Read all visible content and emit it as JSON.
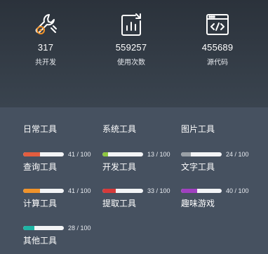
{
  "stats": [
    {
      "icon": "wrench-gear-icon",
      "value": "317",
      "label": "共开发"
    },
    {
      "icon": "bar-chart-icon",
      "value": "559257",
      "label": "使用次数"
    },
    {
      "icon": "code-window-icon",
      "value": "455689",
      "label": "源代码"
    }
  ],
  "categories": [
    "日常工具",
    "系统工具",
    "图片工具"
  ],
  "tools": [
    {
      "name": "查询工具",
      "used": 41,
      "total": 100,
      "count_text": "41 / 100",
      "color": "#e35d3f"
    },
    {
      "name": "开发工具",
      "used": 13,
      "total": 100,
      "count_text": "13 / 100",
      "color": "#8dc63f"
    },
    {
      "name": "文字工具",
      "used": 24,
      "total": 100,
      "count_text": "24 / 100",
      "color": "#9aa0a6"
    },
    {
      "name": "计算工具",
      "used": 41,
      "total": 100,
      "count_text": "41 / 100",
      "color": "#f0932b"
    },
    {
      "name": "提取工具",
      "used": 33,
      "total": 100,
      "count_text": "33 / 100",
      "color": "#d63a3a"
    },
    {
      "name": "趣味游戏",
      "used": 40,
      "total": 100,
      "count_text": "40 / 100",
      "color": "#a040c0"
    },
    {
      "name": "其他工具",
      "used": 28,
      "total": 100,
      "count_text": "28 / 100",
      "color": "#1fb5a5"
    }
  ]
}
